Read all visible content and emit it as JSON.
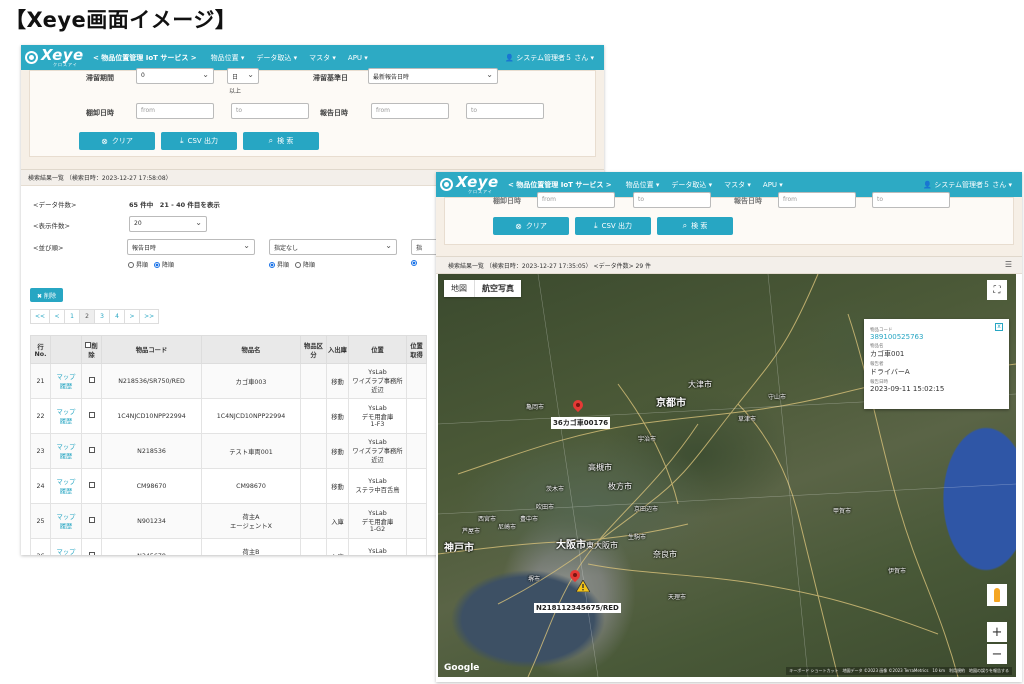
{
  "heading": "【Xeye画面イメージ】",
  "app": {
    "logo_word": "Xeye",
    "logo_sub": "クロスアイ",
    "brand": "< 物品位置管理 IoT サービス >",
    "nav": [
      "物品位置 ▾",
      "データ取込 ▾",
      "マスタ ▾",
      "APU ▾"
    ],
    "user": "👤 システム管理者５ さん ▾"
  },
  "search": {
    "row1": {
      "stay_label": "滞留期間",
      "stay_value": "0",
      "unit_value": "日",
      "suffix": "以上",
      "base_label": "滞留基準日",
      "base_value": "最新報告日時"
    },
    "row2": {
      "shelf_label": "棚卸日時",
      "report_label": "報告日時",
      "from": "from",
      "to": "to"
    },
    "buttons": {
      "clear": "クリア",
      "csv": "CSV 出力",
      "search": "検 索",
      "clear_icon": "⊗",
      "csv_icon": "⤓",
      "search_icon": "⌕"
    }
  },
  "results": {
    "title": "検索結果一覧 （検索日時：2023-12-27 17:58:08）",
    "data_count_label": "<データ件数>",
    "data_count_value": "65 件中　21 - 40 件目を表示",
    "per_page_label": "<表示件数>",
    "per_page_value": "20",
    "sort_label": "<並び順>",
    "sort1_value": "報告日時",
    "sort2_value": "指定なし",
    "sort3_value": "指",
    "asc": "昇順",
    "desc": "降順",
    "delete_button": "✖ 削除",
    "pager": [
      "<<",
      "<",
      "1",
      "2",
      "3",
      "4",
      ">",
      ">>"
    ],
    "columns": [
      "行\nNo.",
      "削除",
      "物品コード",
      "物品名",
      "物品区分",
      "入出庫",
      "位置",
      "位置取得"
    ],
    "map_link": "マップ",
    "history_link": "履歴",
    "rows": [
      {
        "no": "21",
        "code": "N218536/SR750/RED",
        "name": "カゴ車003",
        "kind": "",
        "io": "移動",
        "pos": "YsLab\nワイズラブ事務所近辺"
      },
      {
        "no": "22",
        "code": "1C4NJCD10NPP22994",
        "name": "1C4NJCD10NPP22994",
        "kind": "",
        "io": "移動",
        "pos": "YsLab\nデモ用倉庫\n1-F3"
      },
      {
        "no": "23",
        "code": "N218536",
        "name": "テスト車両001",
        "kind": "",
        "io": "移動",
        "pos": "YsLab\nワイズラブ事務所近辺"
      },
      {
        "no": "24",
        "code": "CM98670",
        "name": "CM98670",
        "kind": "",
        "io": "移動",
        "pos": "YsLab\nステラ中百舌鳥"
      },
      {
        "no": "25",
        "code": "N901234",
        "name": "荷主A\nエージェントX",
        "kind": "",
        "io": "入庫",
        "pos": "YsLab\nデモ用倉庫\n1-G2"
      },
      {
        "no": "26",
        "code": "N345678",
        "name": "荷主B\nエージェントY",
        "kind": "",
        "io": "入庫",
        "pos": "YsLab\nデモ用倉庫"
      }
    ]
  },
  "map_screen": {
    "result_title": "検索結果一覧 （検索日時：2023-12-27 17:35:05） <データ件数> 29 件",
    "from": "from",
    "to": "to",
    "report_label": "報告日時",
    "toggle_map": "地図",
    "toggle_aerial": "航空写真",
    "marker1_label": "36カゴ車00176",
    "marker2_label": "N218112345675/RED",
    "info": {
      "code_label": "物品コード",
      "code_value": "389100525763",
      "name_label": "物品名",
      "name_value": "カゴ車001",
      "person_label": "報告者",
      "person_value": "ドライバーA",
      "date_label": "報告日時",
      "date_value": "2023-09-11 15:02:15",
      "close": "x"
    },
    "cities": [
      "京都市",
      "大津市",
      "高槻市",
      "枚方市",
      "大阪市",
      "東大阪市",
      "奈良市",
      "神戸市",
      "京田辺市",
      "宇治市",
      "亀岡市",
      "草津市",
      "守山市",
      "甲賀市",
      "伊賀市",
      "茨木市",
      "吹田市",
      "豊中市",
      "尼崎市",
      "西宮市",
      "芦屋市",
      "生駒市",
      "天理市",
      "堺市"
    ],
    "google": "Google",
    "attribution": "キーボード ショートカット　地図データ ©2023 画像 ©2023 TerraMetrics　10 km　利用規約　地図の誤りを報告する",
    "zoom_in": "+",
    "zoom_out": "−",
    "fullscreen_icon": "⛶",
    "list_icon": "☰"
  },
  "colors": {
    "navbar": "#2daac4",
    "button": "#27a6c3",
    "marker": "#e53935"
  }
}
